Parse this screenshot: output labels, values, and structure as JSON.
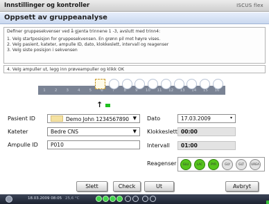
{
  "titlebar": {
    "title": "Innstillinger og kontroller",
    "brand": "ISCUS flex"
  },
  "subtitle": "Oppsett av gruppeanalyse",
  "instructions": {
    "line1": "Definer gruppesekvenser ved å gjenta trinnene 1 -3, avslutt med trinn4:",
    "line2": "1. Velg startposisjon for gruppesekvensen. En grønn pil mot høyre vises.",
    "line3": "2. Velg pasient, kateter, ampulle ID, dato, klokkeslett, intervall og reagenser",
    "line4": "3. Velg siste posisjon i sekvensen",
    "line5": "4. Velg ampuller ut, legg inn prøveampuller og klikk OK"
  },
  "positions": [
    "1",
    "2",
    "3",
    "4",
    "5",
    "6",
    "7",
    "8",
    "9",
    "10",
    "11",
    "12",
    "13",
    "14",
    "15",
    "16"
  ],
  "form": {
    "patient_label": "Pasient ID",
    "patient_value": "Demo John 1234567890",
    "catheter_label": "Kateter",
    "catheter_value": "Bedre CNS",
    "ampoule_label": "Ampulle ID",
    "ampoule_value": "P010",
    "date_label": "Dato",
    "date_value": "17.03.2009",
    "time_label": "Klokkeslett",
    "time_value": "00:00",
    "interval_label": "Intervall",
    "interval_value": "01:00",
    "reagents_label": "Reagenser"
  },
  "reagents": [
    {
      "label": "GLU",
      "on": true
    },
    {
      "label": "LAC",
      "on": true
    },
    {
      "label": "PYR",
      "on": true
    },
    {
      "label": "GLY",
      "on": false
    },
    {
      "label": "GLT",
      "on": false
    },
    {
      "label": "UREA",
      "on": false
    }
  ],
  "buttons": {
    "delete": "Slett",
    "check": "Check",
    "out": "Ut",
    "cancel": "Avbryt"
  },
  "statusbar": {
    "datetime": "18.03.2009 08:05",
    "temperature": "25,6 °C"
  },
  "colors": {
    "accent_green": "#56c41d",
    "selection": "#c99a2a"
  }
}
